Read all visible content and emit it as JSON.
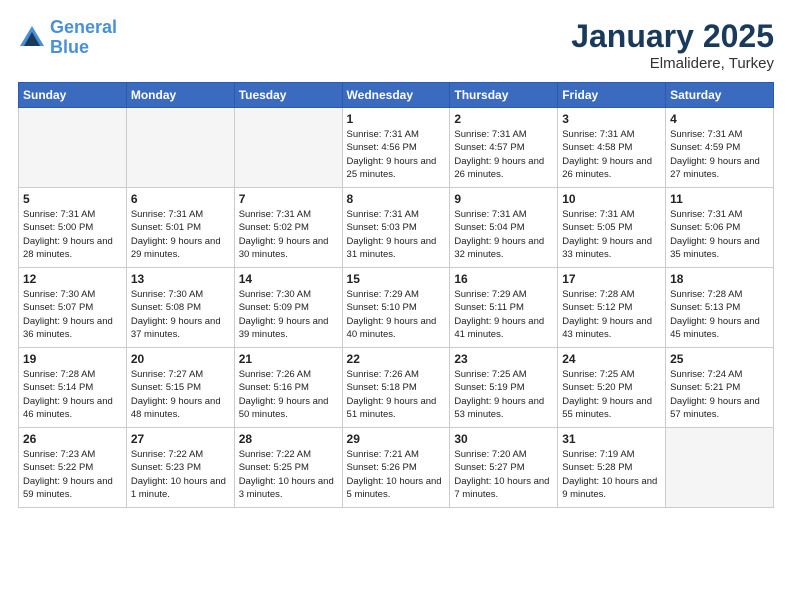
{
  "header": {
    "logo_line1": "General",
    "logo_line2": "Blue",
    "month": "January 2025",
    "location": "Elmalidere, Turkey"
  },
  "weekdays": [
    "Sunday",
    "Monday",
    "Tuesday",
    "Wednesday",
    "Thursday",
    "Friday",
    "Saturday"
  ],
  "weeks": [
    [
      {
        "day": "",
        "info": ""
      },
      {
        "day": "",
        "info": ""
      },
      {
        "day": "",
        "info": ""
      },
      {
        "day": "1",
        "info": "Sunrise: 7:31 AM\nSunset: 4:56 PM\nDaylight: 9 hours\nand 25 minutes."
      },
      {
        "day": "2",
        "info": "Sunrise: 7:31 AM\nSunset: 4:57 PM\nDaylight: 9 hours\nand 26 minutes."
      },
      {
        "day": "3",
        "info": "Sunrise: 7:31 AM\nSunset: 4:58 PM\nDaylight: 9 hours\nand 26 minutes."
      },
      {
        "day": "4",
        "info": "Sunrise: 7:31 AM\nSunset: 4:59 PM\nDaylight: 9 hours\nand 27 minutes."
      }
    ],
    [
      {
        "day": "5",
        "info": "Sunrise: 7:31 AM\nSunset: 5:00 PM\nDaylight: 9 hours\nand 28 minutes."
      },
      {
        "day": "6",
        "info": "Sunrise: 7:31 AM\nSunset: 5:01 PM\nDaylight: 9 hours\nand 29 minutes."
      },
      {
        "day": "7",
        "info": "Sunrise: 7:31 AM\nSunset: 5:02 PM\nDaylight: 9 hours\nand 30 minutes."
      },
      {
        "day": "8",
        "info": "Sunrise: 7:31 AM\nSunset: 5:03 PM\nDaylight: 9 hours\nand 31 minutes."
      },
      {
        "day": "9",
        "info": "Sunrise: 7:31 AM\nSunset: 5:04 PM\nDaylight: 9 hours\nand 32 minutes."
      },
      {
        "day": "10",
        "info": "Sunrise: 7:31 AM\nSunset: 5:05 PM\nDaylight: 9 hours\nand 33 minutes."
      },
      {
        "day": "11",
        "info": "Sunrise: 7:31 AM\nSunset: 5:06 PM\nDaylight: 9 hours\nand 35 minutes."
      }
    ],
    [
      {
        "day": "12",
        "info": "Sunrise: 7:30 AM\nSunset: 5:07 PM\nDaylight: 9 hours\nand 36 minutes."
      },
      {
        "day": "13",
        "info": "Sunrise: 7:30 AM\nSunset: 5:08 PM\nDaylight: 9 hours\nand 37 minutes."
      },
      {
        "day": "14",
        "info": "Sunrise: 7:30 AM\nSunset: 5:09 PM\nDaylight: 9 hours\nand 39 minutes."
      },
      {
        "day": "15",
        "info": "Sunrise: 7:29 AM\nSunset: 5:10 PM\nDaylight: 9 hours\nand 40 minutes."
      },
      {
        "day": "16",
        "info": "Sunrise: 7:29 AM\nSunset: 5:11 PM\nDaylight: 9 hours\nand 41 minutes."
      },
      {
        "day": "17",
        "info": "Sunrise: 7:28 AM\nSunset: 5:12 PM\nDaylight: 9 hours\nand 43 minutes."
      },
      {
        "day": "18",
        "info": "Sunrise: 7:28 AM\nSunset: 5:13 PM\nDaylight: 9 hours\nand 45 minutes."
      }
    ],
    [
      {
        "day": "19",
        "info": "Sunrise: 7:28 AM\nSunset: 5:14 PM\nDaylight: 9 hours\nand 46 minutes."
      },
      {
        "day": "20",
        "info": "Sunrise: 7:27 AM\nSunset: 5:15 PM\nDaylight: 9 hours\nand 48 minutes."
      },
      {
        "day": "21",
        "info": "Sunrise: 7:26 AM\nSunset: 5:16 PM\nDaylight: 9 hours\nand 50 minutes."
      },
      {
        "day": "22",
        "info": "Sunrise: 7:26 AM\nSunset: 5:18 PM\nDaylight: 9 hours\nand 51 minutes."
      },
      {
        "day": "23",
        "info": "Sunrise: 7:25 AM\nSunset: 5:19 PM\nDaylight: 9 hours\nand 53 minutes."
      },
      {
        "day": "24",
        "info": "Sunrise: 7:25 AM\nSunset: 5:20 PM\nDaylight: 9 hours\nand 55 minutes."
      },
      {
        "day": "25",
        "info": "Sunrise: 7:24 AM\nSunset: 5:21 PM\nDaylight: 9 hours\nand 57 minutes."
      }
    ],
    [
      {
        "day": "26",
        "info": "Sunrise: 7:23 AM\nSunset: 5:22 PM\nDaylight: 9 hours\nand 59 minutes."
      },
      {
        "day": "27",
        "info": "Sunrise: 7:22 AM\nSunset: 5:23 PM\nDaylight: 10 hours\nand 1 minute."
      },
      {
        "day": "28",
        "info": "Sunrise: 7:22 AM\nSunset: 5:25 PM\nDaylight: 10 hours\nand 3 minutes."
      },
      {
        "day": "29",
        "info": "Sunrise: 7:21 AM\nSunset: 5:26 PM\nDaylight: 10 hours\nand 5 minutes."
      },
      {
        "day": "30",
        "info": "Sunrise: 7:20 AM\nSunset: 5:27 PM\nDaylight: 10 hours\nand 7 minutes."
      },
      {
        "day": "31",
        "info": "Sunrise: 7:19 AM\nSunset: 5:28 PM\nDaylight: 10 hours\nand 9 minutes."
      },
      {
        "day": "",
        "info": ""
      }
    ]
  ]
}
